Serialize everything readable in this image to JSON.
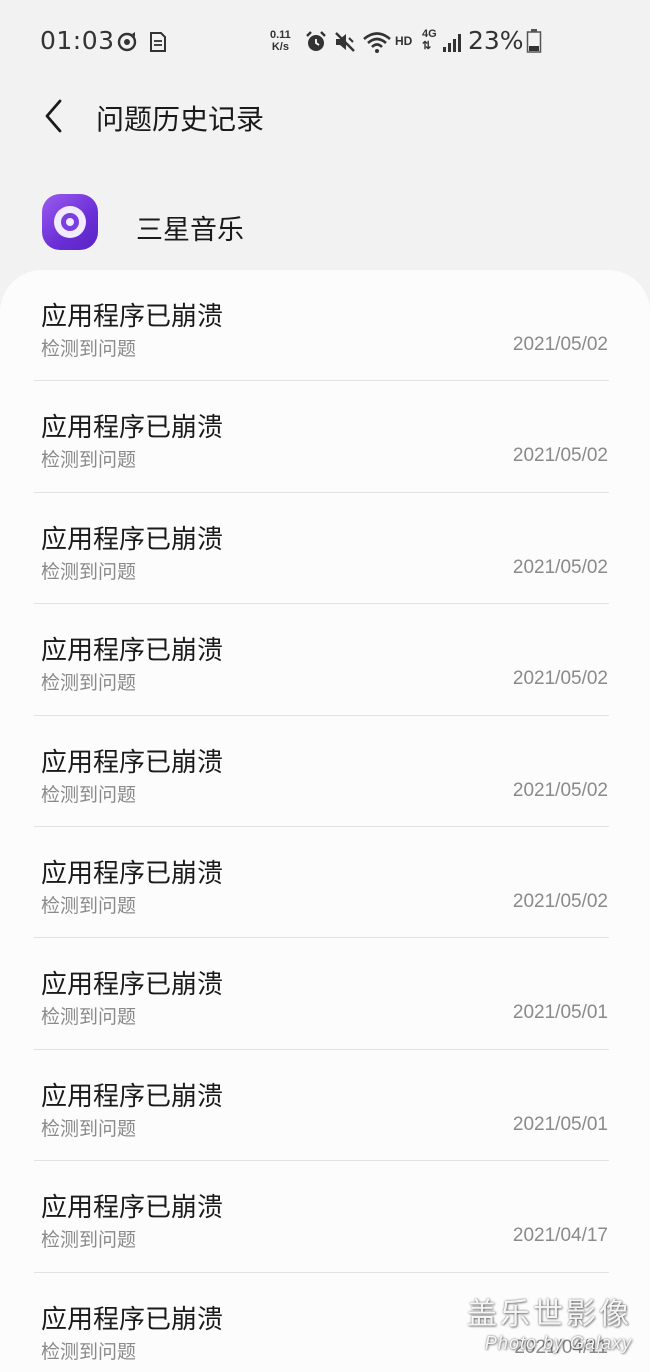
{
  "status_bar": {
    "time": "01:03",
    "net_speed_value": "0.11",
    "net_speed_unit": "K/s",
    "hd_label": "HD",
    "net_type": "4G",
    "battery_percent": "23%"
  },
  "header": {
    "title": "问题历史记录"
  },
  "app": {
    "name": "三星音乐",
    "icon_colors": [
      "#9b5cf0",
      "#5a23c4"
    ]
  },
  "list": {
    "items": [
      {
        "title": "应用程序已崩溃",
        "subtitle": "检测到问题",
        "date": "2021/05/02"
      },
      {
        "title": "应用程序已崩溃",
        "subtitle": "检测到问题",
        "date": "2021/05/02"
      },
      {
        "title": "应用程序已崩溃",
        "subtitle": "检测到问题",
        "date": "2021/05/02"
      },
      {
        "title": "应用程序已崩溃",
        "subtitle": "检测到问题",
        "date": "2021/05/02"
      },
      {
        "title": "应用程序已崩溃",
        "subtitle": "检测到问题",
        "date": "2021/05/02"
      },
      {
        "title": "应用程序已崩溃",
        "subtitle": "检测到问题",
        "date": "2021/05/02"
      },
      {
        "title": "应用程序已崩溃",
        "subtitle": "检测到问题",
        "date": "2021/05/01"
      },
      {
        "title": "应用程序已崩溃",
        "subtitle": "检测到问题",
        "date": "2021/05/01"
      },
      {
        "title": "应用程序已崩溃",
        "subtitle": "检测到问题",
        "date": "2021/04/17"
      },
      {
        "title": "应用程序已崩溃",
        "subtitle": "检测到问题",
        "date": "2021/04/11"
      }
    ]
  },
  "watermark": {
    "line1": "盖乐世影像",
    "line2": "Photo by Galaxy"
  }
}
